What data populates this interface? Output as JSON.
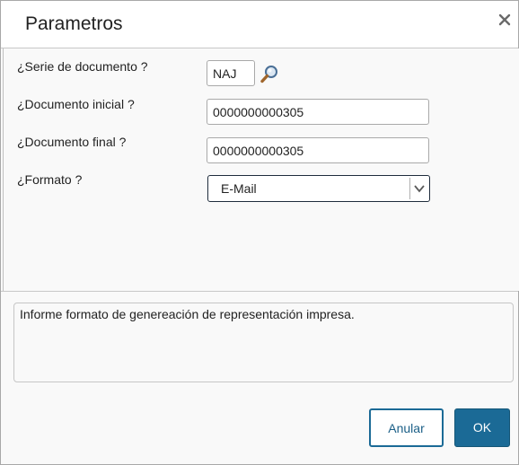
{
  "dialog": {
    "title": "Parametros",
    "close_icon": "close-icon"
  },
  "fields": {
    "serie": {
      "label": "¿Serie de documento ?",
      "value": "NAJ",
      "lookup_icon": "search-icon"
    },
    "documento_inicial": {
      "label": "¿Documento inicial ?",
      "value": "0000000000305"
    },
    "documento_final": {
      "label": "¿Documento final ?",
      "value": "0000000000305"
    },
    "formato": {
      "label": "¿Formato ?",
      "value": "E-Mail",
      "arrow_icon": "chevron-down-icon"
    }
  },
  "help": {
    "text": "Informe formato de genereación de representación impresa."
  },
  "buttons": {
    "cancel_label": "Anular",
    "ok_label": "OK"
  },
  "colors": {
    "primary": "#1b6a96",
    "border": "#a9a9a9",
    "background": "#f9f9f9"
  }
}
